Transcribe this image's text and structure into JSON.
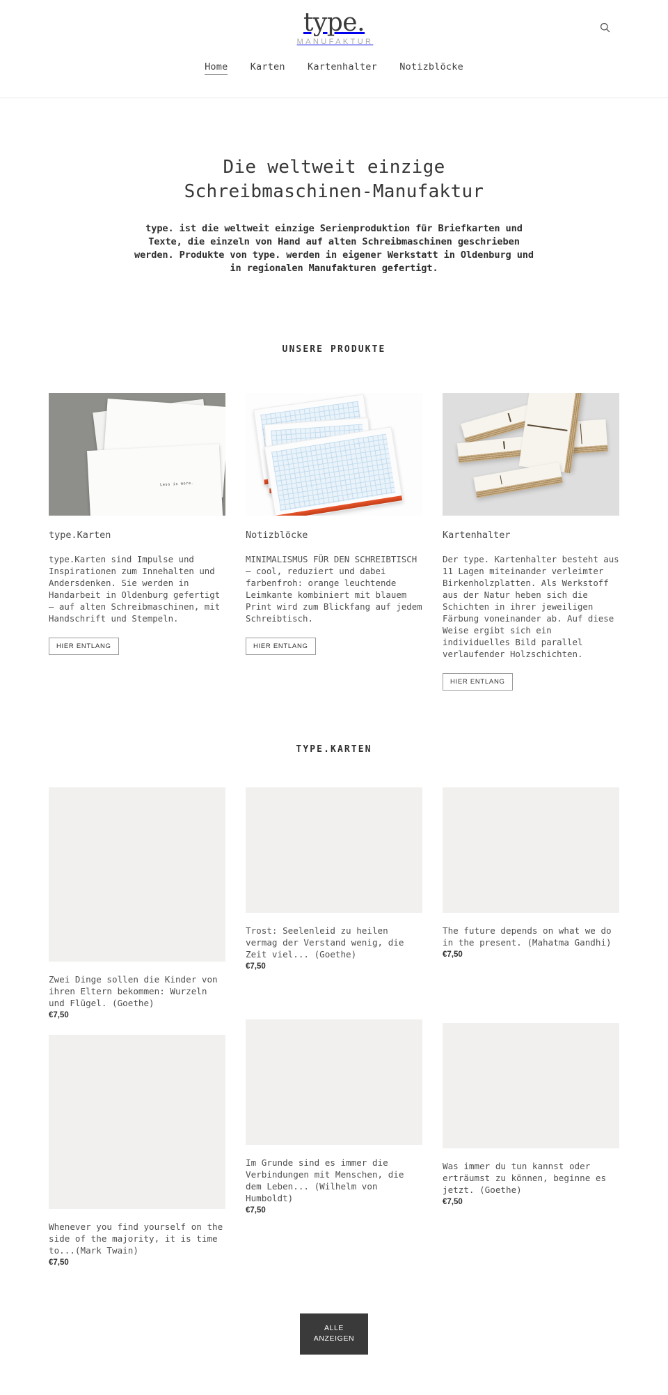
{
  "header": {
    "logo_word": "type.",
    "logo_sub": "MANUFAKTUR",
    "search_icon": "search-icon",
    "nav": [
      {
        "label": "Home",
        "active": true
      },
      {
        "label": "Karten",
        "active": false
      },
      {
        "label": "Kartenhalter",
        "active": false
      },
      {
        "label": "Notizblöcke",
        "active": false
      }
    ]
  },
  "hero": {
    "heading_line1": "Die weltweit einzige",
    "heading_line2": "Schreibmaschinen-Manufaktur",
    "paragraph": "type. ist die weltweit einzige Serienproduktion für Briefkarten und Texte, die einzeln von Hand auf alten Schreibmaschinen geschrieben werden. Produkte von type. werden in eigener Werkstatt in Oldenburg und in regionalen Manufakturen gefertigt."
  },
  "products_section": {
    "title": "UNSERE PRODUKTE",
    "items": [
      {
        "name": "type.Karten",
        "description": "type.Karten sind Impulse und Inspirationen zum Innehalten und Andersdenken. Sie werden in Handarbeit in Oldenburg gefertigt — auf alten Schreibmaschinen, mit Handschrift und Stempeln.",
        "button": "HIER ENTLANG",
        "image_caption": "Less is more."
      },
      {
        "name": "Notizblöcke",
        "description": "MINIMALISMUS FÜR DEN SCHREIBTISCH — cool, reduziert und dabei farbenfroh: orange leuchtende Leimkante kombiniert mit blauem Print wird zum Blickfang auf jedem Schreibtisch.",
        "button": "HIER ENTLANG"
      },
      {
        "name": "Kartenhalter",
        "description": "Der type. Kartenhalter besteht aus 11 Lagen miteinander verleimter Birkenholzplatten. Als Werkstoff aus der Natur heben sich die Schichten in ihrer jeweiligen Färbung voneinander ab. Auf diese Weise ergibt sich ein individuelles Bild parallel verlaufender Holzschichten.",
        "button": "HIER ENTLANG"
      }
    ]
  },
  "karten_section": {
    "title": "TYPE.KARTEN",
    "cards": [
      {
        "title": "Zwei Dinge sollen die Kinder von ihren Eltern bekommen: Wurzeln und Flügel. (Goethe)",
        "price": "€7,50"
      },
      {
        "title": "Trost: Seelenleid zu heilen vermag der Verstand wenig, die Zeit viel... (Goethe)",
        "price": "€7,50"
      },
      {
        "title": "The future depends on what we do in the present. (Mahatma Gandhi)",
        "price": "€7,50"
      },
      {
        "title": "Whenever you find yourself on the side of the majority, it is time to...(Mark Twain)",
        "price": "€7,50"
      },
      {
        "title": "Im Grunde sind es immer die Verbindungen mit Menschen, die dem Leben... (Wilhelm von Humboldt)",
        "price": "€7,50"
      },
      {
        "title": "Was immer du tun kannst oder erträumst zu können, beginne es jetzt. (Goethe)",
        "price": "€7,50"
      }
    ],
    "cta_line1": "ALLE",
    "cta_line2": "ANZEIGEN"
  },
  "colors": {
    "text": "#333333",
    "muted": "#a8a8a8",
    "cta_bg": "#3a3a3a",
    "placeholder": "#f1f0ee",
    "accent_orange": "#e8552a"
  }
}
